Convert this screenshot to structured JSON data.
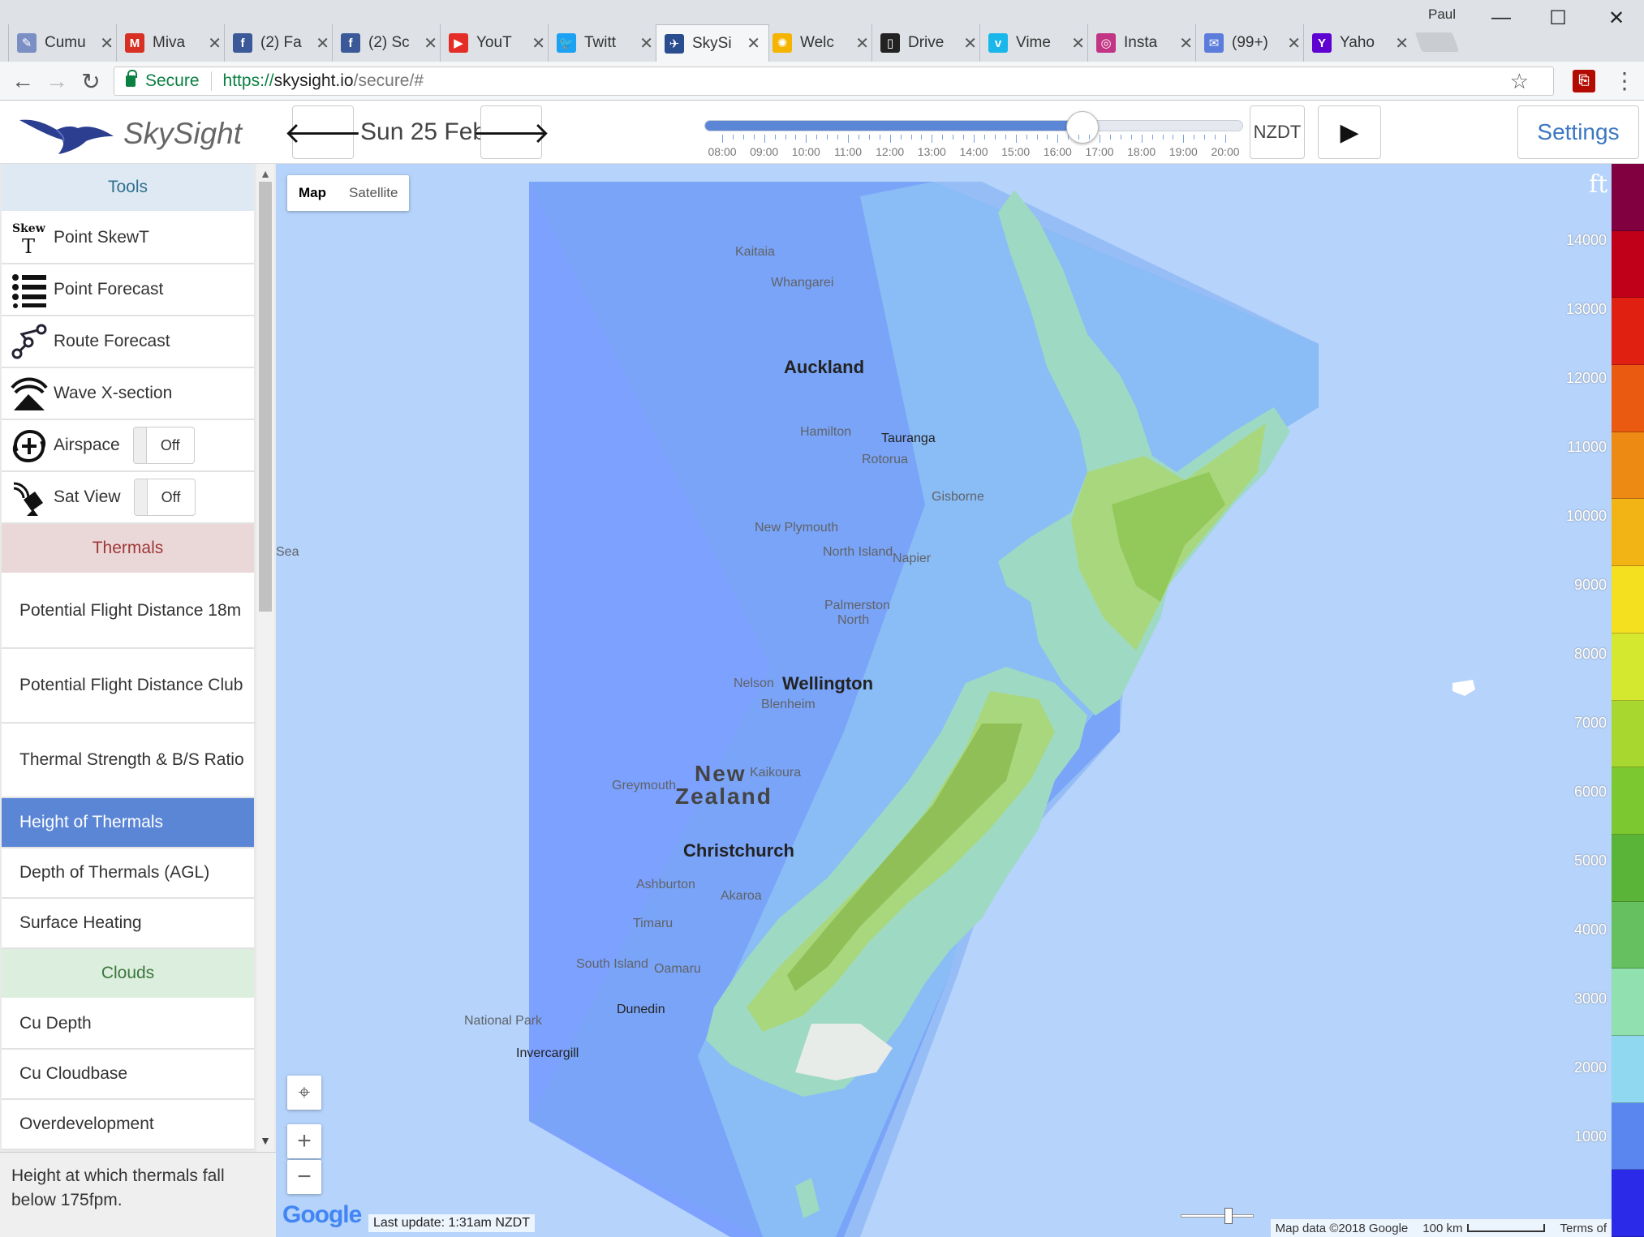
{
  "browser": {
    "tabs": [
      {
        "label": "Cumu",
        "icon": "feather-icon",
        "color": "#7b8fc4"
      },
      {
        "label": "Miva",
        "icon": "gmail-icon",
        "color": "#d93025"
      },
      {
        "label": "(2) Fa",
        "icon": "facebook-icon",
        "color": "#3b5998"
      },
      {
        "label": "(2) Sc",
        "icon": "facebook-icon",
        "color": "#3b5998"
      },
      {
        "label": "YouT",
        "icon": "youtube-icon",
        "color": "#e52d27"
      },
      {
        "label": "Twitt",
        "icon": "twitter-icon",
        "color": "#1da1f2"
      },
      {
        "label": "SkySi",
        "icon": "skysight-icon",
        "color": "#2a4d8f"
      },
      {
        "label": "Welc",
        "icon": "photos-icon",
        "color": "#f4b400"
      },
      {
        "label": "Drive",
        "icon": "terminal-icon",
        "color": "#222222"
      },
      {
        "label": "Vime",
        "icon": "vimeo-icon",
        "color": "#1ab7ea"
      },
      {
        "label": "Insta",
        "icon": "instagram-icon",
        "color": "#c13584"
      },
      {
        "label": "(99+)",
        "icon": "messages-icon",
        "color": "#5c7cdb"
      },
      {
        "label": "Yaho",
        "icon": "yahoo-icon",
        "color": "#5f01d1"
      }
    ],
    "active_tab": 6,
    "profile": "Paul",
    "secure_label": "Secure",
    "url_scheme": "https://",
    "url_host": "skysight.io",
    "url_path": "/secure/#"
  },
  "header": {
    "brand": "SkySight",
    "date": "Sun 25 Feb",
    "timezone": "NZDT",
    "settings": "Settings",
    "time_labels": [
      "08:00",
      "09:00",
      "10:00",
      "11:00",
      "12:00",
      "13:00",
      "14:00",
      "15:00",
      "16:00",
      "17:00",
      "18:00",
      "19:00",
      "20:00"
    ],
    "time_position_fraction": 0.7
  },
  "sidebar": {
    "tools_header": "Tools",
    "tools": [
      {
        "label": "Point SkewT",
        "icon": "skewt-icon"
      },
      {
        "label": "Point Forecast",
        "icon": "list-icon"
      },
      {
        "label": "Route Forecast",
        "icon": "route-icon"
      },
      {
        "label": "Wave X-section",
        "icon": "wave-icon"
      },
      {
        "label": "Airspace",
        "icon": "airspace-icon",
        "toggle": "Off"
      },
      {
        "label": "Sat View",
        "icon": "satellite-icon",
        "toggle": "Off"
      }
    ],
    "thermals_header": "Thermals",
    "thermals": [
      {
        "label": "Potential Flight Distance 18m"
      },
      {
        "label": "Potential Flight Distance Club"
      },
      {
        "label": "Thermal Strength & B/S Ratio"
      },
      {
        "label": "Height of Thermals",
        "active": true
      },
      {
        "label": "Depth of Thermals (AGL)"
      },
      {
        "label": "Surface Heating"
      }
    ],
    "clouds_header": "Clouds",
    "clouds": [
      {
        "label": "Cu Depth"
      },
      {
        "label": "Cu Cloudbase"
      },
      {
        "label": "Overdevelopment"
      }
    ],
    "description": "Height at which thermals fall below 175fpm."
  },
  "map": {
    "type_map": "Map",
    "type_satellite": "Satellite",
    "last_update": "Last update: 1:31am NZDT",
    "google": "Google",
    "map_data": "Map data ©2018 Google",
    "scale": "100 km",
    "terms": "Terms of",
    "labels": {
      "sea": "Sea",
      "kaitaia": "Kaitaia",
      "whangarei": "Whangarei",
      "auckland": "Auckland",
      "hamilton": "Hamilton",
      "tauranga": "Tauranga",
      "rotorua": "Rotorua",
      "gisborne": "Gisborne",
      "new_plymouth": "New Plymouth",
      "north_island": "North Island",
      "napier": "Napier",
      "palmerston": "Palmerston",
      "north": "North",
      "nelson": "Nelson",
      "wellington": "Wellington",
      "blenheim": "Blenheim",
      "greymouth": "Greymouth",
      "kaikoura": "Kaikoura",
      "new": "New",
      "zealand": "Zealand",
      "christchurch": "Christchurch",
      "ashburton": "Ashburton",
      "akaroa": "Akaroa",
      "timaru": "Timaru",
      "south_island": "South Island",
      "oamaru": "Oamaru",
      "dunedin": "Dunedin",
      "national_park": "National Park",
      "invercargill": "Invercargill"
    }
  },
  "legend": {
    "unit": "ft",
    "ticks": [
      "14000",
      "13000",
      "12000",
      "11000",
      "10000",
      "9000",
      "8000",
      "7000",
      "6000",
      "5000",
      "4000",
      "3000",
      "2000",
      "1000"
    ],
    "colors": [
      "#800040",
      "#c00018",
      "#e02010",
      "#ea5a10",
      "#ec8a14",
      "#f2b414",
      "#f5e020",
      "#d4e830",
      "#a8d830",
      "#7cc830",
      "#5ab438",
      "#66c060",
      "#90e0b0",
      "#90d8f0",
      "#5a86f0",
      "#2a2ae8"
    ]
  }
}
